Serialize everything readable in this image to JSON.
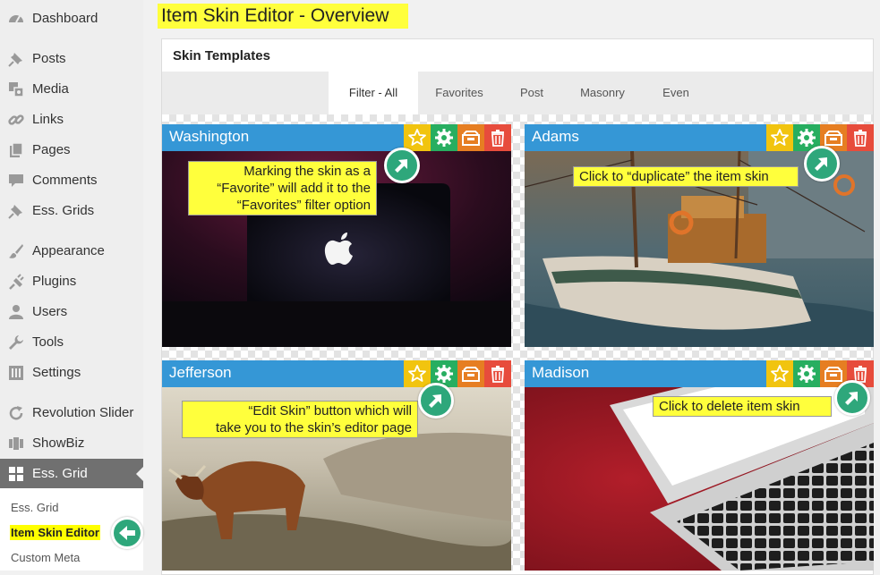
{
  "sidebar": {
    "items": [
      {
        "label": "Dashboard",
        "icon": "dashboard-icon"
      },
      {
        "label": "Posts",
        "icon": "pin-icon"
      },
      {
        "label": "Media",
        "icon": "media-icon"
      },
      {
        "label": "Links",
        "icon": "link-icon"
      },
      {
        "label": "Pages",
        "icon": "pages-icon"
      },
      {
        "label": "Comments",
        "icon": "comment-icon"
      },
      {
        "label": "Ess. Grids",
        "icon": "pin-icon"
      },
      {
        "label": "Appearance",
        "icon": "paintbrush-icon"
      },
      {
        "label": "Plugins",
        "icon": "plug-icon"
      },
      {
        "label": "Users",
        "icon": "user-icon"
      },
      {
        "label": "Tools",
        "icon": "wrench-icon"
      },
      {
        "label": "Settings",
        "icon": "settings-icon"
      },
      {
        "label": "Revolution Slider",
        "icon": "refresh-icon"
      },
      {
        "label": "ShowBiz",
        "icon": "showbiz-icon"
      },
      {
        "label": "Ess. Grid",
        "icon": "grid-icon"
      }
    ],
    "submenu": [
      "Ess. Grid",
      "Item Skin Editor",
      "Custom Meta"
    ]
  },
  "page": {
    "title": "Item Skin Editor - Overview"
  },
  "panel": {
    "title": "Skin Templates"
  },
  "filters": [
    "Filter - All",
    "Favorites",
    "Post",
    "Masonry",
    "Even"
  ],
  "active_filter": "Filter - All",
  "cards": [
    {
      "title": "Washington"
    },
    {
      "title": "Adams"
    },
    {
      "title": "Jefferson"
    },
    {
      "title": "Madison"
    }
  ],
  "annotations": {
    "favorite": [
      "Marking the skin as a",
      "“Favorite” will add it to the",
      "“Favorites” filter option"
    ],
    "duplicate": [
      "Click to “duplicate” the item skin"
    ],
    "edit": [
      "“Edit Skin” button which will",
      "take you to the skin’s editor page"
    ],
    "delete": [
      "Click to delete item skin"
    ]
  },
  "colors": {
    "highlight": "#ffff3c",
    "card_header": "#3597d6",
    "favorite_button": "#f1c40f",
    "edit_button": "#27ae60",
    "duplicate_button": "#e67e22",
    "delete_button": "#e74c3c",
    "callout_arrow": "#2ea77b"
  }
}
